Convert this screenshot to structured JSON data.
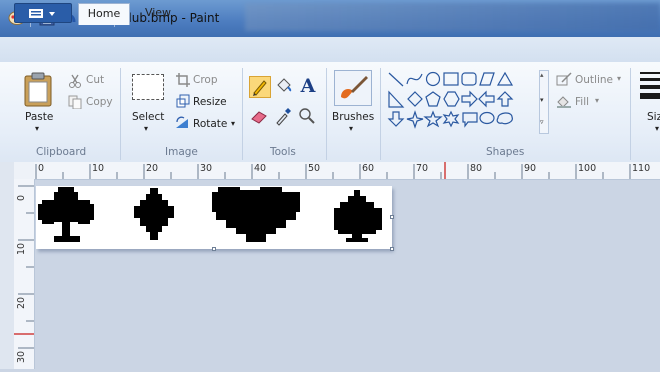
{
  "window": {
    "title": "Club.bmp - Paint"
  },
  "tabs": [
    {
      "label": "Home"
    },
    {
      "label": "View"
    }
  ],
  "clipboard": {
    "paste": "Paste",
    "cut": "Cut",
    "copy": "Copy",
    "group": "Clipboard"
  },
  "image": {
    "select": "Select",
    "crop": "Crop",
    "resize": "Resize",
    "rotate": "Rotate",
    "group": "Image"
  },
  "tools": {
    "group": "Tools",
    "text_glyph": "A"
  },
  "brushes": {
    "label": "Brushes"
  },
  "shapes": {
    "outline": "Outline",
    "fill": "Fill",
    "group": "Shapes"
  },
  "size": {
    "label": "Siz"
  },
  "ruler": {
    "h_labels": [
      "0",
      "10",
      "20",
      "30",
      "40",
      "50",
      "60",
      "70",
      "80",
      "90",
      "100",
      "110"
    ],
    "v_labels": [
      "0",
      "10",
      "20",
      "30"
    ]
  },
  "canvas": {
    "shapes": [
      "club",
      "diamond",
      "heart",
      "spade"
    ]
  },
  "colors": {
    "accent_blue": "#2a5da8",
    "selected_tool": "#fbd87a",
    "ruler_marker": "#d04040"
  }
}
